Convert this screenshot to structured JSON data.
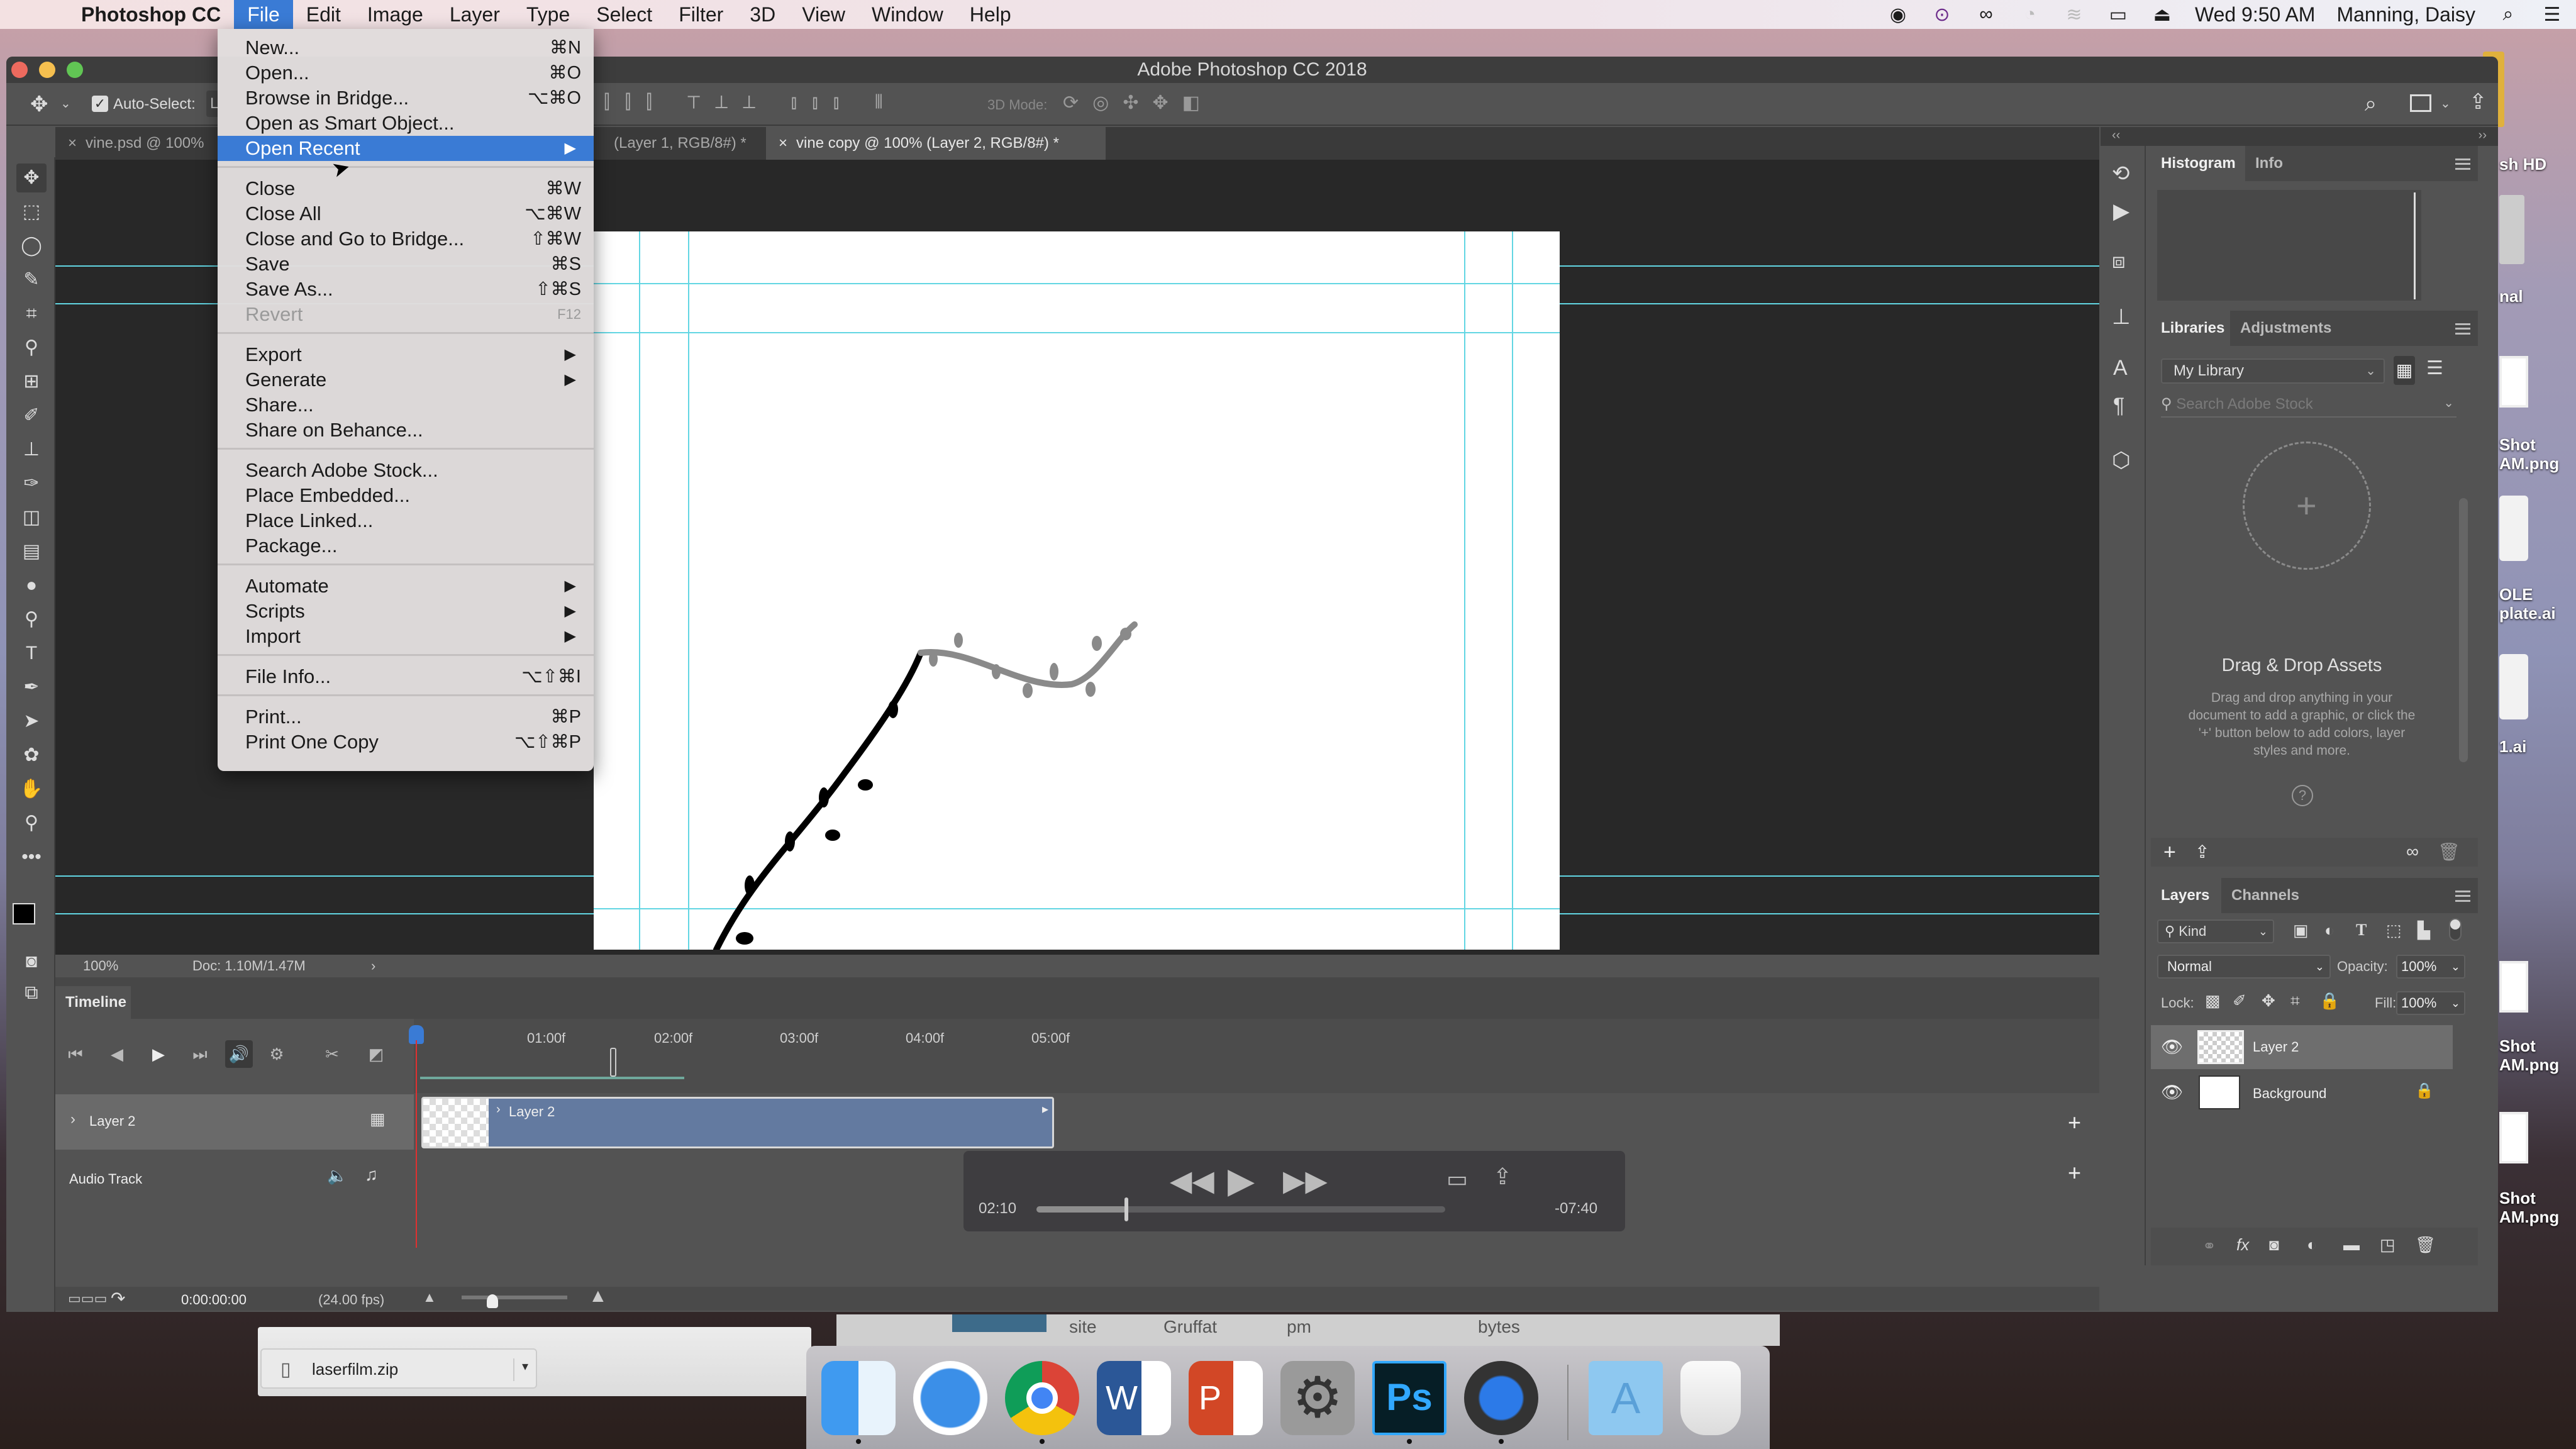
{
  "menubar": {
    "app_name": "Photoshop CC",
    "items": [
      "File",
      "Edit",
      "Image",
      "Layer",
      "Type",
      "Select",
      "Filter",
      "3D",
      "View",
      "Window",
      "Help"
    ],
    "active_item": "File",
    "clock": "Wed 9:50 AM",
    "user": "Manning, Daisy",
    "status_icons": [
      "screen-record-icon",
      "vpn-icon",
      "creative-cloud-icon",
      "time-machine-icon",
      "wifi-icon",
      "airplay-icon",
      "eject-icon",
      "spotlight-icon",
      "notification-center-icon"
    ]
  },
  "window": {
    "title": "Adobe Photoshop CC 2018"
  },
  "options_bar": {
    "auto_select_label": "Auto-Select:",
    "auto_select_checked": true,
    "auto_select_value": "L",
    "mode_3d_label": "3D Mode:"
  },
  "doc_tabs": [
    {
      "label": "vine.psd @ 100%",
      "active": false
    },
    {
      "label": "(Layer 1, RGB/8#) *",
      "active": false
    },
    {
      "label": "vine copy @ 100% (Layer 2, RGB/8#) *",
      "active": true
    }
  ],
  "file_menu": {
    "items": [
      {
        "label": "New...",
        "shortcut": "⌘N"
      },
      {
        "label": "Open...",
        "shortcut": "⌘O"
      },
      {
        "label": "Browse in Bridge...",
        "shortcut": "⌥⌘O"
      },
      {
        "label": "Open as Smart Object...",
        "shortcut": ""
      },
      {
        "label": "Open Recent",
        "submenu": true,
        "highlighted": true
      },
      {
        "separator": true
      },
      {
        "label": "Close",
        "shortcut": "⌘W"
      },
      {
        "label": "Close All",
        "shortcut": "⌥⌘W"
      },
      {
        "label": "Close and Go to Bridge...",
        "shortcut": "⇧⌘W"
      },
      {
        "label": "Save",
        "shortcut": "⌘S"
      },
      {
        "label": "Save As...",
        "shortcut": "⇧⌘S"
      },
      {
        "label": "Revert",
        "shortcut": "F12",
        "disabled": true
      },
      {
        "separator": true
      },
      {
        "label": "Export",
        "submenu": true
      },
      {
        "label": "Generate",
        "submenu": true
      },
      {
        "label": "Share...",
        "shortcut": ""
      },
      {
        "label": "Share on Behance...",
        "shortcut": ""
      },
      {
        "separator": true
      },
      {
        "label": "Search Adobe Stock...",
        "shortcut": ""
      },
      {
        "label": "Place Embedded...",
        "shortcut": ""
      },
      {
        "label": "Place Linked...",
        "shortcut": ""
      },
      {
        "label": "Package...",
        "shortcut": ""
      },
      {
        "separator": true
      },
      {
        "label": "Automate",
        "submenu": true
      },
      {
        "label": "Scripts",
        "submenu": true
      },
      {
        "label": "Import",
        "submenu": true
      },
      {
        "separator": true
      },
      {
        "label": "File Info...",
        "shortcut": "⌥⇧⌘I"
      },
      {
        "separator": true
      },
      {
        "label": "Print...",
        "shortcut": "⌘P"
      },
      {
        "label": "Print One Copy",
        "shortcut": "⌥⇧⌘P"
      }
    ]
  },
  "tools": [
    "move",
    "marquee",
    "lasso",
    "quick-select",
    "crop",
    "eyedropper",
    "healing",
    "brush",
    "stamp",
    "history-brush",
    "eraser",
    "gradient",
    "blur",
    "dodge",
    "type",
    "pen",
    "path-select",
    "shape",
    "hand",
    "zoom",
    "more"
  ],
  "status_bar": {
    "zoom": "100%",
    "doc_size": "Doc: 1.10M/1.47M"
  },
  "timeline": {
    "title": "Timeline",
    "ruler_labels": [
      "01:00f",
      "02:00f",
      "03:00f",
      "04:00f",
      "05:00f"
    ],
    "tracks": [
      {
        "name": "Layer 2",
        "clip_label": "Layer 2"
      },
      {
        "name": "Audio Track"
      }
    ],
    "timecode": "0:00:00:00",
    "fps": "(24.00 fps)"
  },
  "video_player": {
    "elapsed": "02:10",
    "remaining": "-07:40",
    "progress": 0.22
  },
  "histogram_panel": {
    "tabs": [
      "Histogram",
      "Info"
    ],
    "active": "Histogram"
  },
  "libraries_panel": {
    "tabs": [
      "Libraries",
      "Adjustments"
    ],
    "active": "Libraries",
    "library_select": "My Library",
    "search_placeholder": "Search Adobe Stock",
    "empty_title": "Drag & Drop Assets",
    "empty_desc": "Drag and drop anything in your document to add a graphic, or click the '+' button below to add colors, layer styles and more."
  },
  "layers_panel": {
    "tabs": [
      "Layers",
      "Channels"
    ],
    "active": "Layers",
    "filter_kind": "Kind",
    "blend_mode": "Normal",
    "opacity_label": "Opacity:",
    "opacity": "100%",
    "lock_label": "Lock:",
    "fill_label": "Fill:",
    "fill": "100%",
    "layers": [
      {
        "name": "Layer 2",
        "visible": true,
        "selected": true,
        "locked": false
      },
      {
        "name": "Background",
        "visible": true,
        "selected": false,
        "locked": true
      }
    ]
  },
  "download_bar": {
    "file": "laserfilm.zip"
  },
  "behind_window_text": [
    "site",
    "Gruffat",
    "pm",
    "bytes"
  ],
  "dock": {
    "apps": [
      {
        "name": "Finder",
        "running": true
      },
      {
        "name": "Safari",
        "running": false
      },
      {
        "name": "Chrome",
        "running": true
      },
      {
        "name": "Word",
        "running": false
      },
      {
        "name": "PowerPoint",
        "running": false
      },
      {
        "name": "System Preferences",
        "running": false
      },
      {
        "name": "Photoshop",
        "running": true
      },
      {
        "name": "QuickTime",
        "running": true
      },
      {
        "name": "Applications",
        "running": false
      },
      {
        "name": "Trash",
        "running": false
      }
    ]
  },
  "desktop_labels": [
    "sh HD",
    "nal",
    "Shot\nAM.png",
    "OLE\nplate.ai",
    "1.ai",
    "Shot\nAM.png",
    "Shot\nAM.png"
  ]
}
